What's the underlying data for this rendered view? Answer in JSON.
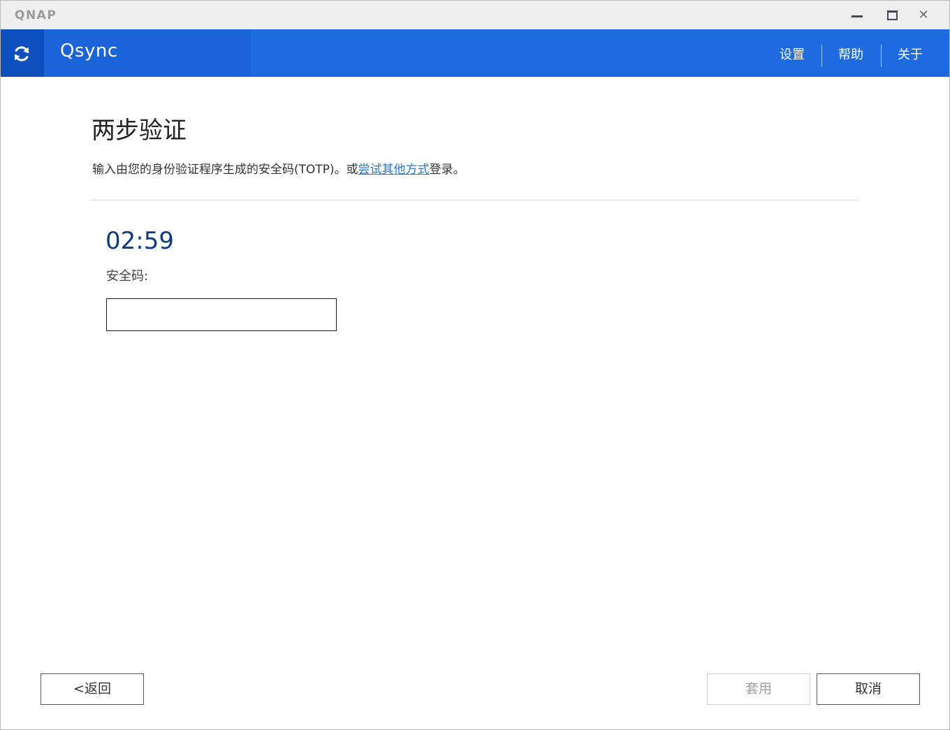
{
  "window": {
    "brand": "QNAP",
    "close_glyph": "✕"
  },
  "header": {
    "app_name": "Qsync",
    "logo_icon": "sync-icon",
    "nav": {
      "settings": "设置",
      "help": "帮助",
      "about": "关于"
    },
    "colors": {
      "header_bg": "#1e6be0",
      "logo_bg": "#0f4fbd"
    }
  },
  "content": {
    "title": "两步验证",
    "description_prefix": "输入由您的身份验证程序生成的安全码(TOTP)。或",
    "description_link": "尝试其他方式",
    "description_suffix": "登录。",
    "timer": "02:59",
    "code_label": "安全码:",
    "code_value": "",
    "code_placeholder": ""
  },
  "footer": {
    "back_label": "<返回",
    "apply_label": "套用",
    "cancel_label": "取消",
    "apply_enabled": false
  }
}
